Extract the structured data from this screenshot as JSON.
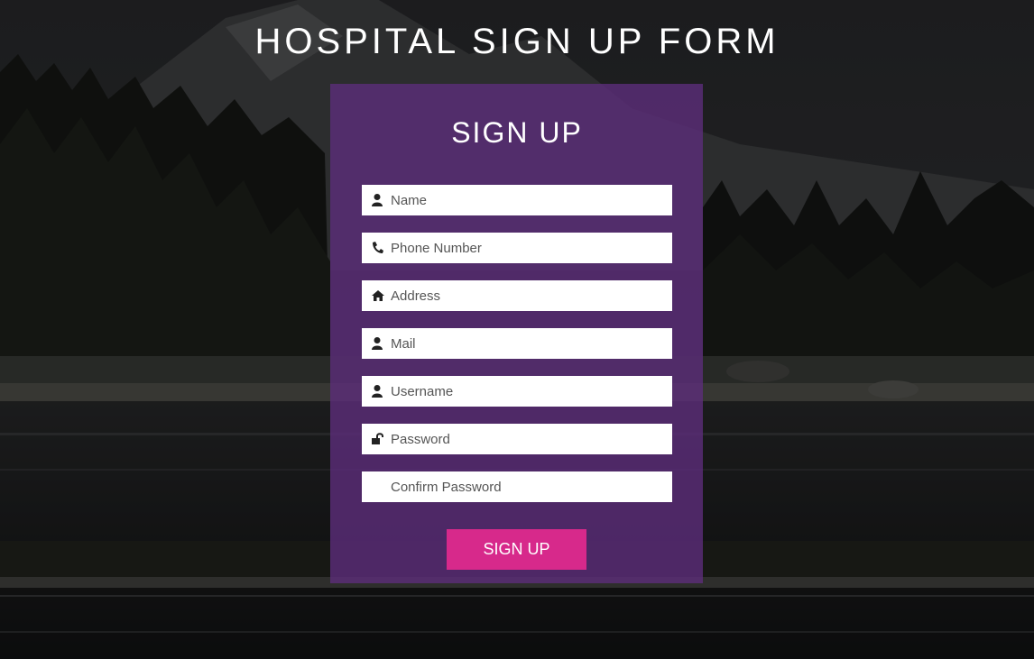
{
  "page": {
    "title": "HOSPITAL SIGN UP FORM"
  },
  "form": {
    "title": "SIGN UP",
    "fields": [
      {
        "placeholder": "Name",
        "icon": "user-icon",
        "type": "text"
      },
      {
        "placeholder": "Phone Number",
        "icon": "phone-icon",
        "type": "tel"
      },
      {
        "placeholder": "Address",
        "icon": "home-icon",
        "type": "text"
      },
      {
        "placeholder": "Mail",
        "icon": "user-icon",
        "type": "email"
      },
      {
        "placeholder": "Username",
        "icon": "user-icon",
        "type": "text"
      },
      {
        "placeholder": "Password",
        "icon": "unlock-icon",
        "type": "password"
      },
      {
        "placeholder": "Confirm Password",
        "icon": "",
        "type": "password"
      }
    ],
    "submit_label": "SIGN UP"
  },
  "colors": {
    "card_background": "#5d2d7b",
    "submit_button": "#d7298b",
    "text_light": "#ffffff"
  }
}
